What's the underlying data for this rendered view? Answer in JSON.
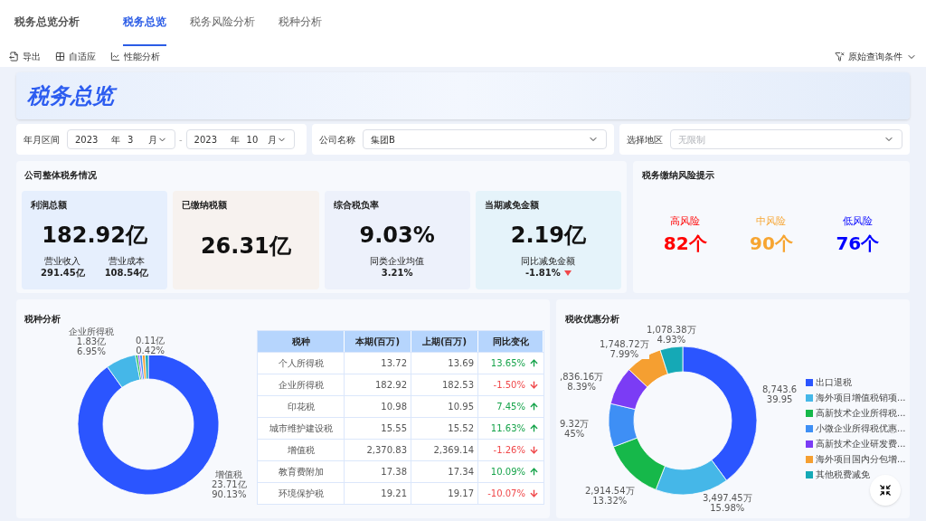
{
  "app_title": "税务总览分析",
  "tabs": [
    {
      "label": "税务总览",
      "selected": true
    },
    {
      "label": "税务风险分析",
      "selected": false
    },
    {
      "label": "税种分析",
      "selected": false
    }
  ],
  "toolbar": [
    {
      "label": "导出",
      "kind": "export"
    },
    {
      "label": "自适应",
      "kind": "fit"
    },
    {
      "label": "性能分析",
      "kind": "perf"
    }
  ],
  "query_button": "原始查询条件",
  "banner_title": "税务总览",
  "filters": {
    "period_label": "年月区间",
    "start_year": "2023",
    "start_year_unit": "年",
    "start_month": "3",
    "start_month_unit": "月",
    "separator": "-",
    "end_year": "2023",
    "end_year_unit": "年",
    "end_month": "10",
    "end_month_unit": "月",
    "company_label": "公司名称",
    "company_value": "集团B",
    "region_label": "选择地区",
    "region_placeholder": "无限制"
  },
  "overview": {
    "title": "公司整体税务情况",
    "cards": [
      {
        "kind": "split",
        "title": "利润总额",
        "value": "182.92亿",
        "stats": [
          {
            "label": "营业收入",
            "value": "291.45亿"
          },
          {
            "label": "营业成本",
            "value": "108.54亿"
          }
        ]
      },
      {
        "kind": "single",
        "title": "已缴纳税额",
        "value": "26.31亿"
      },
      {
        "kind": "compare",
        "title": "综合税负率",
        "value": "9.03%",
        "compare_label": "同类企业均值",
        "compare_value": "3.21%",
        "decrease": false
      },
      {
        "kind": "compare",
        "title": "当期减免金额",
        "value": "2.19亿",
        "compare_label": "同比减免金额",
        "compare_value": "-1.81%",
        "decrease": true
      }
    ]
  },
  "risk": {
    "title": "税务缴纳风险提示",
    "levels": [
      {
        "label": "高风险",
        "count": "82个",
        "color": "#ff0000"
      },
      {
        "label": "中风险",
        "count": "90个",
        "color": "#f7a531"
      },
      {
        "label": "低风险",
        "count": "76个",
        "color": "#0000ff"
      }
    ]
  },
  "tax_types": {
    "title": "税种分析",
    "labels": [
      {
        "lines": [
          "企业所得税",
          "1.83亿",
          "6.95%"
        ]
      },
      {
        "lines": [
          "0.11亿",
          "0.42%"
        ]
      },
      {
        "lines": [
          "增值税",
          "23.71亿",
          "90.13%"
        ]
      }
    ],
    "columns": [
      "税种",
      "本期(百万)",
      "上期(百万)",
      "同比变化"
    ],
    "rows": [
      {
        "name": "个人所得税",
        "current": "13.72",
        "previous": "13.69",
        "change": "13.65%",
        "kind": "up"
      },
      {
        "name": "企业所得税",
        "current": "182.92",
        "previous": "182.53",
        "change": "-1.50%",
        "kind": "down"
      },
      {
        "name": "印花税",
        "current": "10.98",
        "previous": "10.95",
        "change": "7.45%",
        "kind": "up"
      },
      {
        "name": "城市维护建设税",
        "current": "15.55",
        "previous": "15.52",
        "change": "11.63%",
        "kind": "up"
      },
      {
        "name": "增值税",
        "current": "2,370.83",
        "previous": "2,369.14",
        "change": "-1.26%",
        "kind": "down"
      },
      {
        "name": "教育费附加",
        "current": "17.38",
        "previous": "17.34",
        "change": "10.09%",
        "kind": "up"
      },
      {
        "name": "环境保护税",
        "current": "19.21",
        "previous": "19.17",
        "change": "-10.07%",
        "kind": "down"
      }
    ]
  },
  "incentives": {
    "title": "税收优惠分析",
    "chart_data": {
      "type": "donut",
      "categories": [
        "出口退税",
        "海外项目增值税销项...",
        "高新技术企业所得税...",
        "小微企业所得税优惠...",
        "高新技术企业研发费...",
        "海外项目国内分包增...",
        "其他税费减免"
      ],
      "values": [
        39.95,
        15.98,
        13.32,
        9.45,
        8.39,
        7.99,
        4.93
      ],
      "colors": [
        "#2b55ff",
        "#45b7e8",
        "#16b84a",
        "#3e8ff5",
        "#7b3cf5",
        "#f59f31",
        "#15a9b6"
      ]
    },
    "labels": [
      {
        "lines": [
          "1,078.38万",
          "4.93%"
        ]
      },
      {
        "lines": [
          "1,748.72万",
          "7.99%"
        ]
      },
      {
        "lines": [
          ",836.16万",
          "8.39%"
        ]
      },
      {
        "lines": [
          "8,743.6",
          "39.95"
        ]
      },
      {
        "lines": [
          "9.32万",
          "45%"
        ]
      },
      {
        "lines": [
          "2,914.54万",
          "13.32%"
        ]
      },
      {
        "lines": [
          "3,497.45万",
          "15.98%"
        ]
      }
    ]
  }
}
